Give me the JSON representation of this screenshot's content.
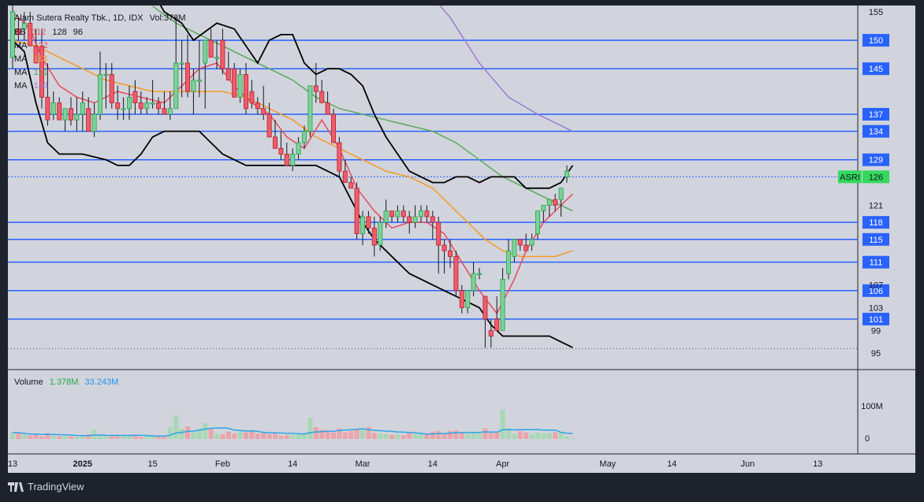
{
  "header": {
    "symbol_line": "Alam Sutera Realty Tbk., 1D, IDX",
    "volume_text": "Vol:378M",
    "indicators": [
      {
        "name": "BB",
        "values": [
          "112",
          "128",
          "96"
        ]
      },
      {
        "name": "MA",
        "value": "122"
      },
      {
        "name": "MA",
        "value": "113"
      },
      {
        "name": "MA",
        "value": "121"
      },
      {
        "name": "MA",
        "value": "133"
      }
    ]
  },
  "volume_legend": {
    "label": "Volume",
    "value1": "1.378M",
    "value2": "33.243M"
  },
  "footer": {
    "brand": "TradingView"
  },
  "colors": {
    "up": "#7fcf9c",
    "up_border": "#26a646",
    "down": "#ef5c6a",
    "down_border": "#b8202f",
    "level_line": "#2962ff",
    "level_label_bg": "#2962ff",
    "ma_fast": "#e84b5a",
    "ma_mid": "#f79a26",
    "ma_green": "#5aaa5e",
    "ma_purple": "#9d7ad6",
    "bb": "#000000",
    "price_label_bg": "#33d95c",
    "volume_ma": "#2ea5e8"
  },
  "chart_data": {
    "type": "candlestick",
    "symbol": "ASRI",
    "last_price": 126,
    "y_ticks": [
      155,
      121,
      107,
      103,
      99,
      95
    ],
    "levels": [
      150,
      145,
      137,
      134,
      129,
      126,
      118,
      115,
      111,
      106,
      101
    ],
    "x_labels": [
      "13",
      "2025",
      "15",
      "Feb",
      "14",
      "Mar",
      "14",
      "Apr",
      "May",
      "14",
      "Jun",
      "13"
    ],
    "volume_ticks": [
      "100M",
      "0"
    ],
    "candles": [
      {
        "o": 147,
        "h": 160,
        "l": 145,
        "c": 155
      },
      {
        "o": 152,
        "h": 154,
        "l": 150,
        "c": 151
      },
      {
        "o": 152,
        "h": 155,
        "l": 150,
        "c": 153
      },
      {
        "o": 153,
        "h": 155,
        "l": 149,
        "c": 149
      },
      {
        "o": 149,
        "h": 152,
        "l": 146,
        "c": 146
      },
      {
        "o": 149,
        "h": 152,
        "l": 138,
        "c": 140
      },
      {
        "o": 140,
        "h": 146,
        "l": 135,
        "c": 136
      },
      {
        "o": 137,
        "h": 141,
        "l": 136,
        "c": 139
      },
      {
        "o": 139,
        "h": 140,
        "l": 136,
        "c": 136
      },
      {
        "o": 136,
        "h": 138,
        "l": 134,
        "c": 138
      },
      {
        "o": 138,
        "h": 140,
        "l": 135,
        "c": 136
      },
      {
        "o": 136,
        "h": 140,
        "l": 134,
        "c": 137
      },
      {
        "o": 137,
        "h": 141,
        "l": 134,
        "c": 139
      },
      {
        "o": 138,
        "h": 140,
        "l": 134,
        "c": 134
      },
      {
        "o": 134,
        "h": 139,
        "l": 133,
        "c": 137
      },
      {
        "o": 137,
        "h": 148,
        "l": 136,
        "c": 144
      },
      {
        "o": 144,
        "h": 146,
        "l": 138,
        "c": 144
      },
      {
        "o": 144,
        "h": 146,
        "l": 138,
        "c": 139
      },
      {
        "o": 139,
        "h": 142,
        "l": 136,
        "c": 138
      },
      {
        "o": 138,
        "h": 140,
        "l": 136,
        "c": 138
      },
      {
        "o": 138,
        "h": 142,
        "l": 136,
        "c": 140
      },
      {
        "o": 141,
        "h": 143,
        "l": 137,
        "c": 139
      },
      {
        "o": 139,
        "h": 141,
        "l": 137,
        "c": 138
      },
      {
        "o": 138,
        "h": 140,
        "l": 137,
        "c": 139
      },
      {
        "o": 139,
        "h": 143,
        "l": 138,
        "c": 139
      },
      {
        "o": 139,
        "h": 140,
        "l": 137,
        "c": 138
      },
      {
        "o": 138,
        "h": 141,
        "l": 137,
        "c": 137
      },
      {
        "o": 137,
        "h": 141,
        "l": 136,
        "c": 138
      },
      {
        "o": 138,
        "h": 154,
        "l": 138,
        "c": 146
      },
      {
        "o": 146,
        "h": 150,
        "l": 140,
        "c": 146
      },
      {
        "o": 146,
        "h": 151,
        "l": 140,
        "c": 141
      },
      {
        "o": 141,
        "h": 145,
        "l": 137,
        "c": 143
      },
      {
        "o": 143,
        "h": 150,
        "l": 140,
        "c": 143
      },
      {
        "o": 146,
        "h": 150,
        "l": 138,
        "c": 150
      },
      {
        "o": 150,
        "h": 152,
        "l": 147,
        "c": 147
      },
      {
        "o": 147,
        "h": 150,
        "l": 145,
        "c": 147
      },
      {
        "o": 150,
        "h": 152,
        "l": 144,
        "c": 145
      },
      {
        "o": 145,
        "h": 148,
        "l": 143,
        "c": 143
      },
      {
        "o": 145,
        "h": 146,
        "l": 140,
        "c": 140
      },
      {
        "o": 140,
        "h": 145,
        "l": 139,
        "c": 144
      },
      {
        "o": 144,
        "h": 146,
        "l": 137,
        "c": 138
      },
      {
        "o": 141,
        "h": 143,
        "l": 138,
        "c": 139
      },
      {
        "o": 139,
        "h": 140,
        "l": 137,
        "c": 138
      },
      {
        "o": 138,
        "h": 142,
        "l": 136,
        "c": 137
      },
      {
        "o": 137,
        "h": 139,
        "l": 133,
        "c": 133
      },
      {
        "o": 133,
        "h": 136,
        "l": 131,
        "c": 131
      },
      {
        "o": 131,
        "h": 134,
        "l": 129,
        "c": 130
      },
      {
        "o": 130,
        "h": 132,
        "l": 128,
        "c": 128
      },
      {
        "o": 128,
        "h": 131,
        "l": 127,
        "c": 130
      },
      {
        "o": 130,
        "h": 133,
        "l": 129,
        "c": 132
      },
      {
        "o": 132,
        "h": 135,
        "l": 131,
        "c": 134
      },
      {
        "o": 134,
        "h": 142,
        "l": 133,
        "c": 142
      },
      {
        "o": 142,
        "h": 146,
        "l": 139,
        "c": 141
      },
      {
        "o": 141,
        "h": 143,
        "l": 139,
        "c": 139
      },
      {
        "o": 139,
        "h": 141,
        "l": 137,
        "c": 137
      },
      {
        "o": 137,
        "h": 138,
        "l": 133,
        "c": 132
      },
      {
        "o": 132,
        "h": 133,
        "l": 126,
        "c": 127
      },
      {
        "o": 127,
        "h": 129,
        "l": 125,
        "c": 125
      },
      {
        "o": 125,
        "h": 126,
        "l": 124,
        "c": 124
      },
      {
        "o": 124,
        "h": 125,
        "l": 115,
        "c": 116
      },
      {
        "o": 116,
        "h": 120,
        "l": 114,
        "c": 119
      },
      {
        "o": 119,
        "h": 120,
        "l": 116,
        "c": 117
      },
      {
        "o": 117,
        "h": 119,
        "l": 112,
        "c": 114
      },
      {
        "o": 114,
        "h": 119,
        "l": 113,
        "c": 118
      },
      {
        "o": 118,
        "h": 122,
        "l": 117,
        "c": 120
      },
      {
        "o": 120,
        "h": 120,
        "l": 118,
        "c": 119
      },
      {
        "o": 119,
        "h": 121,
        "l": 118,
        "c": 120
      },
      {
        "o": 120,
        "h": 121,
        "l": 118,
        "c": 119
      },
      {
        "o": 119,
        "h": 120,
        "l": 116,
        "c": 118
      },
      {
        "o": 118,
        "h": 121,
        "l": 117,
        "c": 119
      },
      {
        "o": 119,
        "h": 121,
        "l": 118,
        "c": 120
      },
      {
        "o": 120,
        "h": 121,
        "l": 118,
        "c": 119
      },
      {
        "o": 119,
        "h": 120,
        "l": 115,
        "c": 118
      },
      {
        "o": 118,
        "h": 119,
        "l": 109,
        "c": 114
      },
      {
        "o": 114,
        "h": 115,
        "l": 109,
        "c": 113
      },
      {
        "o": 113,
        "h": 115,
        "l": 110,
        "c": 112
      },
      {
        "o": 112,
        "h": 113,
        "l": 105,
        "c": 106
      },
      {
        "o": 106,
        "h": 107,
        "l": 102,
        "c": 103
      },
      {
        "o": 103,
        "h": 106,
        "l": 102,
        "c": 106
      },
      {
        "o": 106,
        "h": 111,
        "l": 105,
        "c": 109
      },
      {
        "o": 109,
        "h": 110,
        "l": 108,
        "c": 109
      },
      {
        "o": 105,
        "h": 105,
        "l": 96,
        "c": 101
      },
      {
        "o": 99,
        "h": 101,
        "l": 96,
        "c": 98
      },
      {
        "o": 101,
        "h": 105,
        "l": 99,
        "c": 99
      },
      {
        "o": 99,
        "h": 110,
        "l": 99,
        "c": 108
      },
      {
        "o": 109,
        "h": 115,
        "l": 108,
        "c": 113
      },
      {
        "o": 112,
        "h": 115,
        "l": 111,
        "c": 115
      },
      {
        "o": 115,
        "h": 115,
        "l": 113,
        "c": 114
      },
      {
        "o": 114,
        "h": 116,
        "l": 113,
        "c": 113
      },
      {
        "o": 114,
        "h": 116,
        "l": 113,
        "c": 115
      },
      {
        "o": 116,
        "h": 119,
        "l": 115,
        "c": 120
      },
      {
        "o": 120,
        "h": 121,
        "l": 118,
        "c": 121
      },
      {
        "o": 121,
        "h": 122,
        "l": 119,
        "c": 122
      },
      {
        "o": 122,
        "h": 123,
        "l": 120,
        "c": 121
      },
      {
        "o": 122,
        "h": 124,
        "l": 119,
        "c": 124
      },
      {
        "o": 126,
        "h": 128,
        "l": 125,
        "c": 127
      }
    ],
    "volume": [
      20,
      18,
      12,
      10,
      14,
      8,
      18,
      10,
      8,
      10,
      8,
      6,
      8,
      14,
      28,
      10,
      8,
      8,
      8,
      8,
      10,
      10,
      6,
      12,
      8,
      10,
      6,
      36,
      72,
      30,
      38,
      20,
      32,
      48,
      30,
      16,
      14,
      22,
      16,
      22,
      20,
      24,
      16,
      20,
      14,
      16,
      10,
      12,
      12,
      14,
      14,
      64,
      36,
      28,
      26,
      20,
      32,
      20,
      24,
      28,
      30,
      36,
      18,
      16,
      14,
      12,
      14,
      12,
      18,
      14,
      16,
      14,
      22,
      24,
      18,
      24,
      26,
      18,
      16,
      18,
      16,
      32,
      18,
      20,
      88,
      32,
      16,
      24,
      20,
      14,
      20,
      16,
      18,
      20,
      20,
      8,
      2
    ],
    "ma_fast": [
      [
        0,
        155
      ],
      [
        3,
        152
      ],
      [
        5,
        147
      ],
      [
        8,
        142
      ],
      [
        11,
        140
      ],
      [
        14,
        139
      ],
      [
        18,
        141
      ],
      [
        22,
        140
      ],
      [
        26,
        139
      ],
      [
        29,
        142
      ],
      [
        32,
        145
      ],
      [
        35,
        146
      ],
      [
        38,
        142
      ],
      [
        41,
        139
      ],
      [
        44,
        137
      ],
      [
        47,
        133
      ],
      [
        50,
        131
      ],
      [
        53,
        136
      ],
      [
        56,
        131
      ],
      [
        59,
        124
      ],
      [
        62,
        120
      ],
      [
        65,
        117
      ],
      [
        68,
        118
      ],
      [
        71,
        118
      ],
      [
        74,
        116
      ],
      [
        77,
        111
      ],
      [
        80,
        106
      ],
      [
        83,
        102
      ],
      [
        86,
        108
      ],
      [
        88,
        113
      ],
      [
        91,
        118
      ],
      [
        94,
        121
      ],
      [
        96,
        123
      ]
    ],
    "ma_mid": [
      [
        0,
        150
      ],
      [
        4,
        149
      ],
      [
        8,
        147
      ],
      [
        12,
        145
      ],
      [
        16,
        143
      ],
      [
        20,
        142
      ],
      [
        24,
        141
      ],
      [
        28,
        141
      ],
      [
        32,
        141
      ],
      [
        36,
        141
      ],
      [
        40,
        140
      ],
      [
        44,
        138
      ],
      [
        48,
        136
      ],
      [
        52,
        133
      ],
      [
        56,
        131
      ],
      [
        60,
        129
      ],
      [
        64,
        127
      ],
      [
        68,
        126
      ],
      [
        72,
        124
      ],
      [
        75,
        121
      ],
      [
        78,
        118
      ],
      [
        81,
        115
      ],
      [
        84,
        113
      ],
      [
        87,
        112
      ],
      [
        90,
        112
      ],
      [
        93,
        112
      ],
      [
        96,
        113
      ]
    ],
    "ma_green": [
      [
        24,
        156
      ],
      [
        28,
        153
      ],
      [
        32,
        151
      ],
      [
        36,
        149
      ],
      [
        40,
        147
      ],
      [
        44,
        145
      ],
      [
        48,
        143
      ],
      [
        52,
        140
      ],
      [
        56,
        138
      ],
      [
        60,
        137
      ],
      [
        64,
        136
      ],
      [
        68,
        135
      ],
      [
        72,
        134
      ],
      [
        76,
        132
      ],
      [
        80,
        129
      ],
      [
        84,
        126
      ],
      [
        88,
        124
      ],
      [
        92,
        122
      ],
      [
        96,
        120
      ]
    ],
    "ma_purple": [
      [
        65,
        164
      ],
      [
        70,
        160
      ],
      [
        75,
        154
      ],
      [
        80,
        146
      ],
      [
        85,
        140
      ],
      [
        90,
        137
      ],
      [
        96,
        134
      ]
    ],
    "bb_upper": [
      [
        22,
        162
      ],
      [
        26,
        155
      ],
      [
        29,
        153
      ],
      [
        31,
        150
      ],
      [
        35,
        153
      ],
      [
        38,
        152
      ],
      [
        40,
        149
      ],
      [
        42,
        146
      ],
      [
        44,
        150
      ],
      [
        46,
        151
      ],
      [
        48,
        151
      ],
      [
        50,
        146
      ],
      [
        52,
        144
      ],
      [
        54,
        145
      ],
      [
        56,
        145
      ],
      [
        58,
        144
      ],
      [
        60,
        142
      ],
      [
        62,
        137
      ],
      [
        64,
        133
      ],
      [
        66,
        130
      ],
      [
        68,
        127
      ],
      [
        70,
        126
      ],
      [
        72,
        125
      ],
      [
        74,
        125
      ],
      [
        76,
        126
      ],
      [
        78,
        126
      ],
      [
        80,
        125
      ],
      [
        82,
        126
      ],
      [
        84,
        126
      ],
      [
        86,
        126
      ],
      [
        88,
        124
      ],
      [
        90,
        124
      ],
      [
        92,
        124
      ],
      [
        94,
        125
      ],
      [
        96,
        128
      ]
    ],
    "bb_lower": [
      [
        0,
        150
      ],
      [
        2,
        148
      ],
      [
        4,
        139
      ],
      [
        6,
        132
      ],
      [
        8,
        130
      ],
      [
        12,
        130
      ],
      [
        16,
        129
      ],
      [
        18,
        128
      ],
      [
        20,
        128
      ],
      [
        22,
        130
      ],
      [
        24,
        133
      ],
      [
        26,
        134
      ],
      [
        28,
        134
      ],
      [
        30,
        134
      ],
      [
        32,
        134
      ],
      [
        34,
        132
      ],
      [
        36,
        130
      ],
      [
        38,
        129
      ],
      [
        40,
        128
      ],
      [
        42,
        128
      ],
      [
        44,
        128
      ],
      [
        48,
        128
      ],
      [
        52,
        128
      ],
      [
        54,
        127
      ],
      [
        56,
        126
      ],
      [
        58,
        122
      ],
      [
        60,
        118
      ],
      [
        62,
        115
      ],
      [
        64,
        113
      ],
      [
        66,
        111
      ],
      [
        68,
        109
      ],
      [
        70,
        108
      ],
      [
        72,
        107
      ],
      [
        74,
        106
      ],
      [
        76,
        105
      ],
      [
        78,
        104
      ],
      [
        80,
        103
      ],
      [
        82,
        100
      ],
      [
        84,
        98
      ],
      [
        86,
        98
      ],
      [
        88,
        98
      ],
      [
        90,
        98
      ],
      [
        92,
        98
      ],
      [
        94,
        97
      ],
      [
        96,
        96
      ]
    ]
  }
}
